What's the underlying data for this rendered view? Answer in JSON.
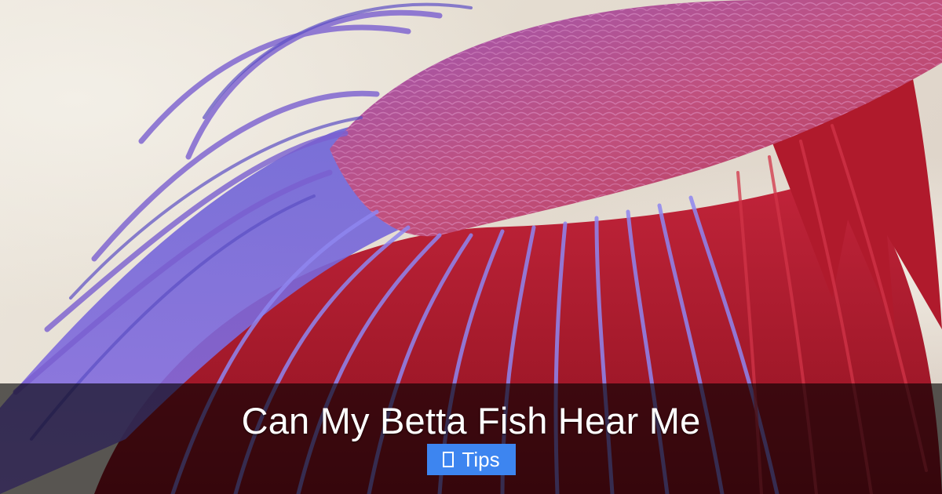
{
  "article": {
    "title": "Can My Betta Fish Hear Me",
    "category": "Tips"
  },
  "image": {
    "subject": "betta fish fins"
  },
  "icons": {
    "category_icon": "tag-icon"
  },
  "colors": {
    "badge_background": "#3d85f0",
    "overlay": "rgba(0,0,0,0.62)",
    "title_text": "#ffffff"
  }
}
